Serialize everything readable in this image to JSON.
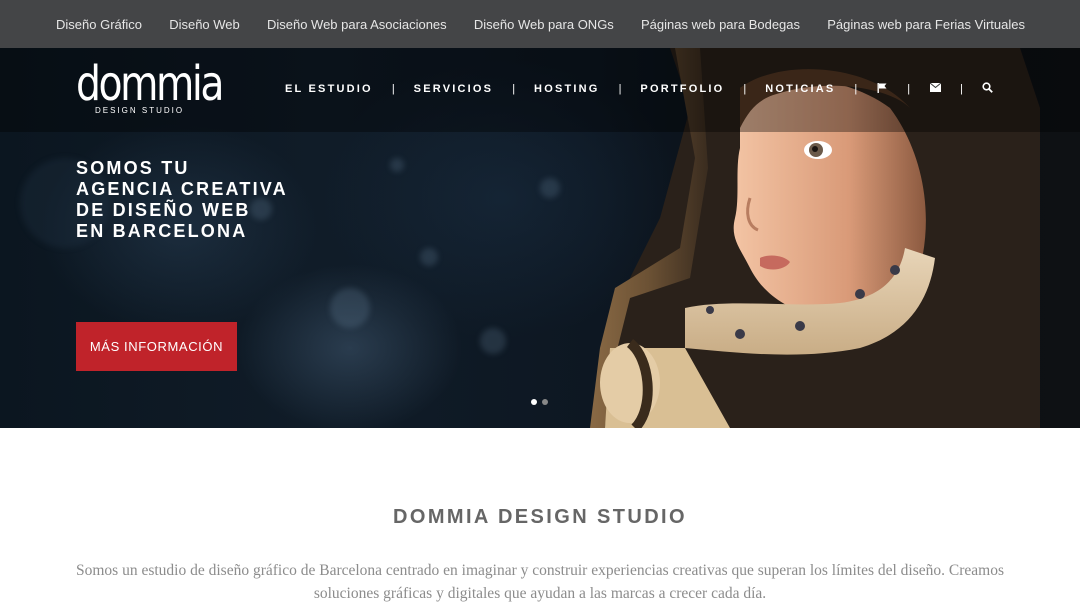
{
  "topbar": {
    "links": [
      "Diseño Gráfico",
      "Diseño Web",
      "Diseño Web para Asociaciones",
      "Diseño Web para ONGs",
      "Páginas web para Bodegas",
      "Páginas web para Ferias Virtuales"
    ]
  },
  "brand": {
    "name": "dommia",
    "tagline": "DESIGN STUDIO"
  },
  "nav": {
    "items": [
      "EL ESTUDIO",
      "SERVICIOS",
      "HOSTING",
      "PORTFOLIO",
      "NOTICIAS"
    ],
    "separator": "|",
    "icons": [
      "flag-icon",
      "envelope-icon",
      "search-icon"
    ]
  },
  "hero": {
    "headline": [
      "SOMOS TU",
      "AGENCIA CREATIVA",
      "DE DISEÑO WEB",
      "EN BARCELONA"
    ],
    "cta_label": "MÁS INFORMACIÓN",
    "slides_total": 2,
    "slide_active": 1,
    "cta_color": "#c0232a"
  },
  "intro": {
    "title": "DOMMIA DESIGN STUDIO",
    "text": "Somos un estudio de diseño gráfico de Barcelona centrado en imaginar y construir experiencias creativas que superan los límites del diseño. Creamos soluciones gráficas y digitales que ayudan a las marcas a crecer cada día."
  }
}
